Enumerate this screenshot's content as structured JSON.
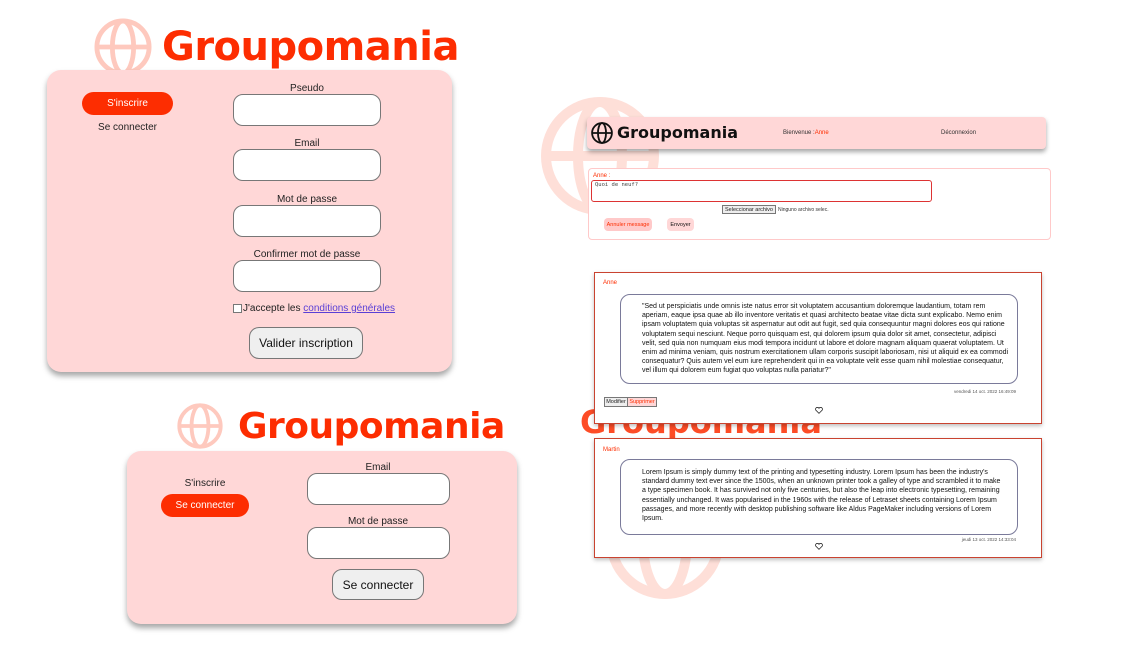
{
  "brand": {
    "name": "Groupomania"
  },
  "signup": {
    "tab_signup": "S'inscrire",
    "tab_login": "Se connecter",
    "pseudo_label": "Pseudo",
    "email_label": "Email",
    "password_label": "Mot de passe",
    "confirm_label": "Confirmer mot de passe",
    "terms_prefix": "J'accepte les ",
    "terms_link": "conditions générales",
    "submit": "Valider inscription"
  },
  "login": {
    "tab_signup": "S'inscrire",
    "tab_login": "Se connecter",
    "email_label": "Email",
    "password_label": "Mot de passe",
    "submit": "Se connecter"
  },
  "feed": {
    "welcome_label": "Bienvenue :",
    "welcome_user": "Anne",
    "logout": "Déconnexion",
    "composer": {
      "author": "Anne :",
      "placeholder": "Quoi de neuf?",
      "file_button": "Seleccionar archivo",
      "file_status": "Ninguno archivo selec.",
      "cancel": "Annuler message",
      "send": "Envoyer"
    },
    "posts": [
      {
        "author": "Anne",
        "text": "\"Sed ut perspiciatis unde omnis iste natus error sit voluptatem accusantium doloremque laudantium, totam rem aperiam, eaque ipsa quae ab illo inventore veritatis et quasi architecto beatae vitae dicta sunt explicabo. Nemo enim ipsam voluptatem quia voluptas sit aspernatur aut odit aut fugit, sed quia consequuntur magni dolores eos qui ratione voluptatem sequi nesciunt. Neque porro quisquam est, qui dolorem ipsum quia dolor sit amet, consectetur, adipisci velit, sed quia non numquam eius modi tempora incidunt ut labore et dolore magnam aliquam quaerat voluptatem. Ut enim ad minima veniam, quis nostrum exercitationem ullam corporis suscipit laboriosam, nisi ut aliquid ex ea commodi consequatur? Quis autem vel eum iure reprehenderit qui in ea voluptate velit esse quam nihil molestiae consequatur, vel illum qui dolorem eum fugiat quo voluptas nulla pariatur?\"",
        "date": "vendredi 14 oct. 2022 16:49:09",
        "edit": "Modifier",
        "delete": "Supprimer"
      },
      {
        "author": "Martin",
        "text": "Lorem Ipsum is simply dummy text of the printing and typesetting industry. Lorem Ipsum has been the industry's standard dummy text ever since the 1500s, when an unknown printer took a galley of type and scrambled it to make a type specimen book. It has survived not only five centuries, but also the leap into electronic typesetting, remaining essentially unchanged. It was popularised in the 1960s with the release of Letraset sheets containing Lorem Ipsum passages, and more recently with desktop publishing software like Aldus PageMaker including versions of Lorem Ipsum.",
        "date": "jeudi 13 oct. 2022 14:33:04"
      }
    ]
  },
  "colors": {
    "accent": "#fd2d01",
    "card": "#ffd7d7",
    "tertiary": "#4e5166"
  },
  "icons": {
    "logo": "globe-icon",
    "like": "heart-icon"
  }
}
